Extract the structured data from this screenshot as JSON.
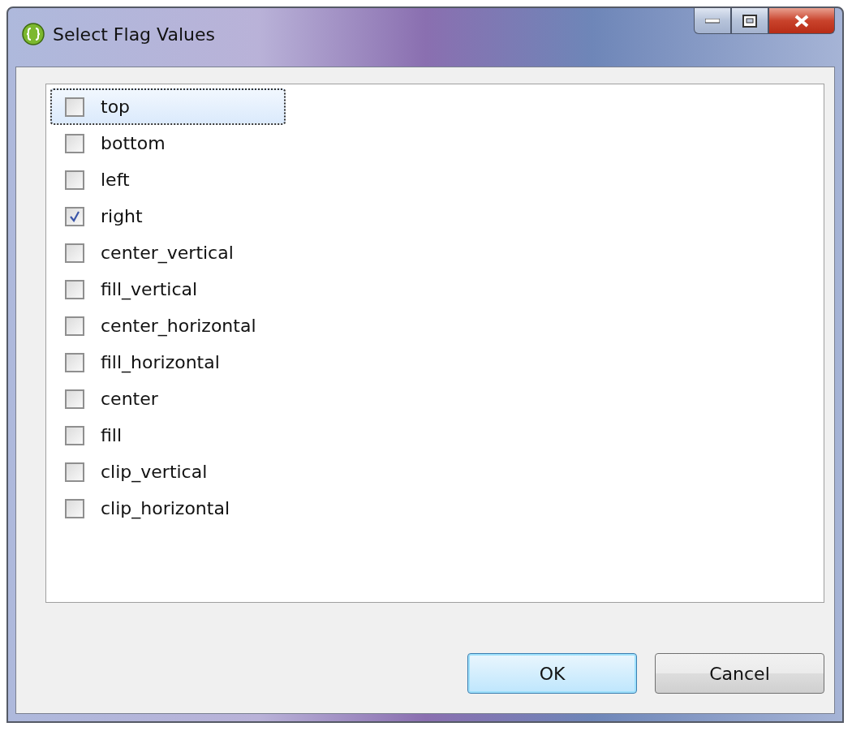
{
  "window": {
    "title": "Select Flag Values"
  },
  "flags": [
    {
      "label": "top",
      "checked": false,
      "selected": true
    },
    {
      "label": "bottom",
      "checked": false,
      "selected": false
    },
    {
      "label": "left",
      "checked": false,
      "selected": false
    },
    {
      "label": "right",
      "checked": true,
      "selected": false
    },
    {
      "label": "center_vertical",
      "checked": false,
      "selected": false
    },
    {
      "label": "fill_vertical",
      "checked": false,
      "selected": false
    },
    {
      "label": "center_horizontal",
      "checked": false,
      "selected": false
    },
    {
      "label": "fill_horizontal",
      "checked": false,
      "selected": false
    },
    {
      "label": "center",
      "checked": false,
      "selected": false
    },
    {
      "label": "fill",
      "checked": false,
      "selected": false
    },
    {
      "label": "clip_vertical",
      "checked": false,
      "selected": false
    },
    {
      "label": "clip_horizontal",
      "checked": false,
      "selected": false
    }
  ],
  "buttons": [
    {
      "label": "OK",
      "kind": "default"
    },
    {
      "label": "Cancel",
      "kind": "normal"
    }
  ]
}
